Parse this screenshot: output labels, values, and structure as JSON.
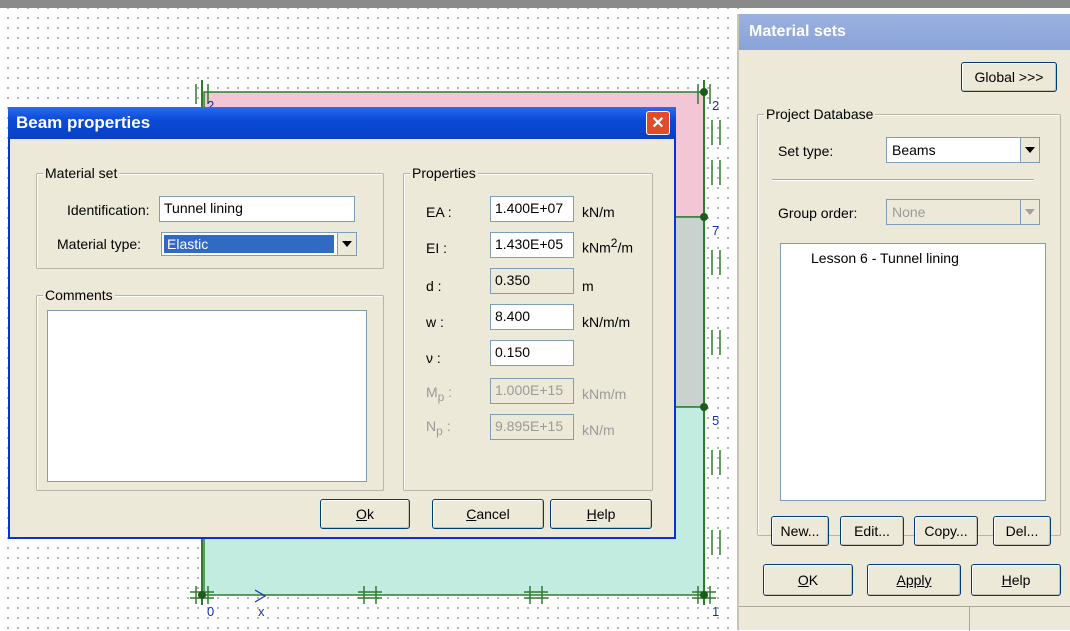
{
  "canvas": {
    "node_labels": [
      "2",
      "2",
      "7",
      "5",
      "0",
      "1"
    ],
    "axis_label": "x"
  },
  "beam_dialog": {
    "title": "Beam properties",
    "material_set": {
      "group_title": "Material set",
      "identification_label": "Identification:",
      "identification_value": "Tunnel lining",
      "material_type_label": "Material type:",
      "material_type_value": "Elastic"
    },
    "comments": {
      "group_title": "Comments",
      "value": ""
    },
    "properties": {
      "group_title": "Properties",
      "rows": [
        {
          "label": "EA :",
          "value": "1.400E+07",
          "unit": "kN/m"
        },
        {
          "label": "EI :",
          "value": "1.430E+05",
          "unit_base": "kNm",
          "unit_sup": "2",
          "unit_tail": "/m"
        },
        {
          "label": "d :",
          "value": "0.350",
          "unit": "m"
        },
        {
          "label": "w :",
          "value": "8.400",
          "unit": "kN/m/m"
        },
        {
          "label": "ν :",
          "value": "0.150",
          "unit": ""
        },
        {
          "label_base": "M",
          "label_sub": "p",
          "label_tail": " :",
          "value": "1.000E+15",
          "unit": "kNm/m"
        },
        {
          "label_base": "N",
          "label_sub": "p",
          "label_tail": " :",
          "value": "9.895E+15",
          "unit": "kN/m"
        }
      ]
    },
    "buttons": {
      "ok_u": "O",
      "ok_rest": "k",
      "cancel_u": "C",
      "cancel_rest": "ancel",
      "help_u": "H",
      "help_rest": "elp"
    }
  },
  "material_sets": {
    "title": "Material sets",
    "global_button": "Global >>>",
    "project_db_title": "Project Database",
    "set_type_label": "Set type:",
    "set_type_value": "Beams",
    "group_order_label": "Group order:",
    "group_order_value": "None",
    "items": [
      "Lesson 6 - Tunnel lining"
    ],
    "buttons": {
      "new": "New...",
      "edit": "Edit...",
      "copy": "Copy...",
      "del": "Del...",
      "ok_u": "O",
      "ok_rest": "K",
      "apply": "Apply",
      "help_u": "H",
      "help_rest": "elp"
    }
  },
  "colors": {
    "pink_region": "#f3c6d6",
    "grey_region": "#c9d2cf",
    "cyan_region": "#c3ece0",
    "geometry_line": "#2e7d2e",
    "node_label": "#1a2fa8",
    "dialog_titlebar": "#0a4bd8"
  }
}
